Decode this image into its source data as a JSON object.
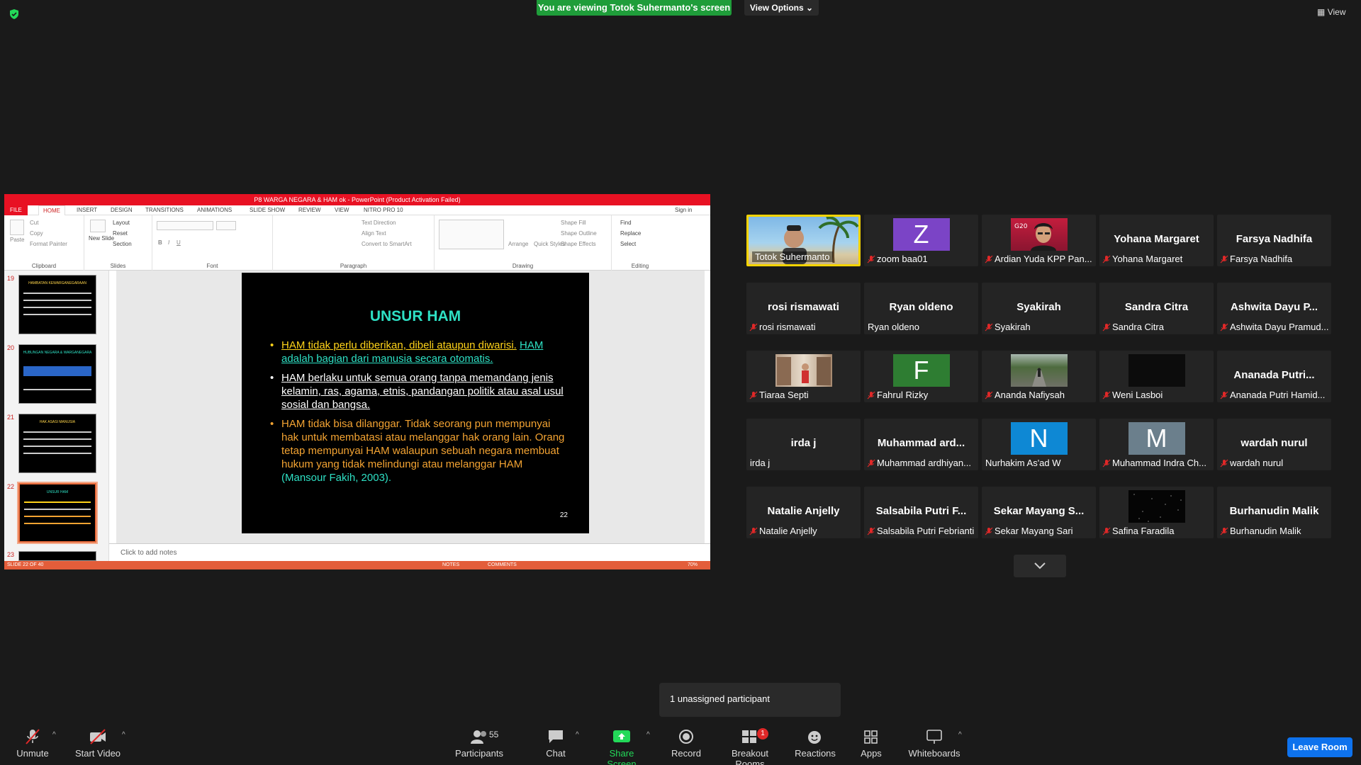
{
  "banner": {
    "viewing": "You are viewing Totok Suhermanto's screen",
    "view_options": "View Options",
    "view": "View"
  },
  "ppt": {
    "title": "P8 WARGA NEGARA & HAM ok - PowerPoint (Product Activation Failed)",
    "tabs": [
      "FILE",
      "HOME",
      "INSERT",
      "DESIGN",
      "TRANSITIONS",
      "ANIMATIONS",
      "SLIDE SHOW",
      "REVIEW",
      "VIEW",
      "NITRO PRO 10"
    ],
    "sign_in": "Sign in",
    "groups": {
      "clipboard": "Clipboard",
      "slides": "Slides",
      "font": "Font",
      "paragraph": "Paragraph",
      "drawing": "Drawing",
      "editing": "Editing"
    },
    "ribbon_items": {
      "paste": "Paste",
      "cut": "Cut",
      "copy": "Copy",
      "format_painter": "Format Painter",
      "new_slide": "New Slide",
      "layout": "Layout",
      "reset": "Reset",
      "section": "Section",
      "text_direction": "Text Direction",
      "align_text": "Align Text",
      "convert_smartart": "Convert to SmartArt",
      "arrange": "Arrange",
      "quick_styles": "Quick Styles",
      "shape_fill": "Shape Fill",
      "shape_outline": "Shape Outline",
      "shape_effects": "Shape Effects",
      "find": "Find",
      "replace": "Replace",
      "select": "Select"
    },
    "thumbnails": [
      {
        "num": "19",
        "title": "HAMBATAN KEWARGANEGARAAN"
      },
      {
        "num": "20",
        "title": "HUBUNGAN NEGARA & WARGANEGARA"
      },
      {
        "num": "21",
        "title": "HAK ASASI MANUSIA"
      },
      {
        "num": "22",
        "title": "UNSUR HAM"
      },
      {
        "num": "23",
        "title": ""
      }
    ],
    "slide": {
      "title": "UNSUR HAM",
      "b1_a": "HAM tidak perlu diberikan, dibeli ataupun diwarisi.",
      "b1_b": "HAM adalah bagian dari manusia secara otomatis.",
      "b2": "HAM berlaku untuk semua orang tanpa memandang jenis kelamin, ras, agama, etnis, pandangan politik atau asal usul sosial dan bangsa.",
      "b3_a": "HAM tidak bisa dilanggar. Tidak seorang pun mempunyai hak untuk membatasi atau melanggar hak orang lain. Orang tetap mempunyai HAM walaupun sebuah negara membuat hukum yang tidak melindungi atau melanggar HAM",
      "b3_b": "(Mansour Fakih, 2003).",
      "number": "22"
    },
    "notes_placeholder": "Click to add notes",
    "status": {
      "slide": "SLIDE 22 OF 40",
      "notes": "NOTES",
      "comments": "COMMENTS",
      "zoom": "70%"
    }
  },
  "participants": [
    {
      "name": "Totok Suhermanto",
      "label": "Totok Suhermanto",
      "type": "video-beach",
      "muted": false,
      "active": true
    },
    {
      "name": "zoom baa01",
      "label": "Z",
      "type": "avatar",
      "color": "#7b44c6",
      "muted": true
    },
    {
      "name": "Ardian Yuda KPP Pan...",
      "label": "",
      "type": "video-red",
      "muted": true
    },
    {
      "name": "Yohana Margaret",
      "label": "Yohana Margaret",
      "type": "text",
      "muted": true
    },
    {
      "name": "Farsya Nadhifa",
      "label": "Farsya Nadhifa",
      "type": "text",
      "muted": true
    },
    {
      "name": "rosi rismawati",
      "label": "rosi rismawati",
      "type": "text",
      "muted": true
    },
    {
      "name": "Ryan oldeno",
      "label": "Ryan oldeno",
      "type": "text",
      "muted": false
    },
    {
      "name": "Syakirah",
      "label": "Syakirah",
      "type": "text",
      "muted": true
    },
    {
      "name": "Sandra Citra",
      "label": "Sandra Citra",
      "type": "text",
      "muted": true
    },
    {
      "name": "Ashwita Dayu Pramud...",
      "label": "Ashwita Dayu P...",
      "type": "text",
      "muted": true
    },
    {
      "name": "Tiaraa Septi",
      "label": "",
      "type": "photo-shop",
      "muted": true
    },
    {
      "name": "Fahrul Rizky",
      "label": "F",
      "type": "avatar",
      "color": "#2e7d32",
      "muted": true
    },
    {
      "name": "Ananda Nafiysah",
      "label": "",
      "type": "photo-road",
      "muted": true
    },
    {
      "name": "Weni Lasboi",
      "label": "",
      "type": "dark",
      "muted": true
    },
    {
      "name": "Ananada Putri Hamid...",
      "label": "Ananada Putri...",
      "type": "text",
      "muted": true
    },
    {
      "name": "irda j",
      "label": "irda j",
      "type": "text",
      "muted": false
    },
    {
      "name": "Muhammad ardhiyan...",
      "label": "Muhammad ard...",
      "type": "text",
      "muted": true
    },
    {
      "name": "Nurhakim As'ad W",
      "label": "N",
      "type": "avatar",
      "color": "#0e88d4",
      "muted": false
    },
    {
      "name": "Muhammad Indra Ch...",
      "label": "M",
      "type": "avatar",
      "color": "#6b7f8c",
      "muted": true
    },
    {
      "name": "wardah nurul",
      "label": "wardah nurul",
      "type": "text",
      "muted": true
    },
    {
      "name": "Natalie Anjelly",
      "label": "Natalie Anjelly",
      "type": "text",
      "muted": true
    },
    {
      "name": "Salsabila Putri Febrianti",
      "label": "Salsabila Putri F...",
      "type": "text",
      "muted": true
    },
    {
      "name": "Sekar Mayang Sari",
      "label": "Sekar Mayang S...",
      "type": "text",
      "muted": true
    },
    {
      "name": "Safina Faradila",
      "label": "",
      "type": "stars",
      "muted": true
    },
    {
      "name": "Burhanudin Malik",
      "label": "Burhanudin Malik",
      "type": "text",
      "muted": true
    }
  ],
  "tooltip": "1 unassigned participant",
  "toolbar": {
    "unmute": "Unmute",
    "start_video": "Start Video",
    "participants": "Participants",
    "participants_count": "55",
    "chat": "Chat",
    "share_screen": "Share Screen",
    "record": "Record",
    "breakout_rooms": "Breakout Rooms",
    "breakout_badge": "1",
    "reactions": "Reactions",
    "apps": "Apps",
    "whiteboards": "Whiteboards",
    "leave_room": "Leave Room"
  },
  "colors": {
    "banner_green": "#1f9d3a",
    "leave_blue": "#0e72ed",
    "share_green": "#23d959",
    "active_border": "#f5d300",
    "ppt_red": "#e81123"
  }
}
